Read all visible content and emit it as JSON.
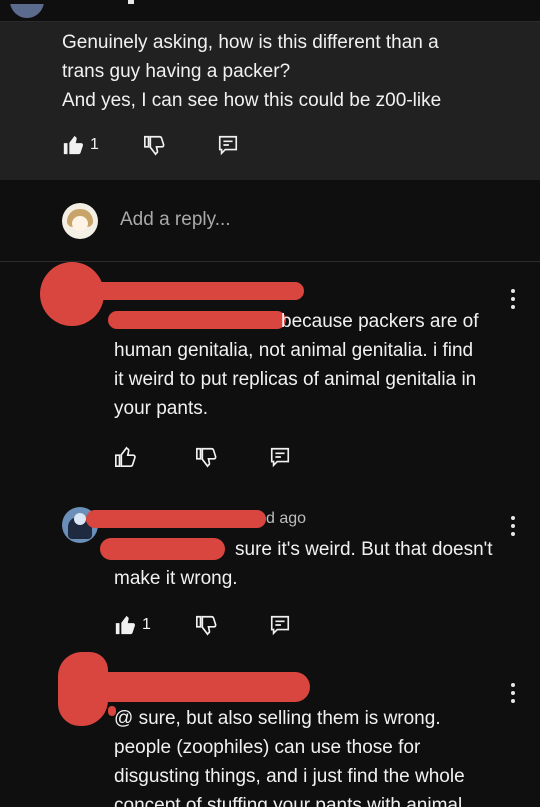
{
  "parent_comment": {
    "text_lines": [
      "Genuinely asking, how is this different than a",
      "trans guy having a packer?",
      "And yes, I can see how this could be z00-like"
    ],
    "like_count": "1"
  },
  "reply_box": {
    "placeholder": "Add a reply..."
  },
  "replies": [
    {
      "text_lines": [
        "because packers are of",
        "human genitalia, not animal genitalia. i find",
        "it weird to put replicas of animal genitalia in",
        "your pants."
      ],
      "like_count": ""
    },
    {
      "meta": "d ago",
      "text_lines": [
        "sure it's weird. But that doesn't",
        "make it wrong."
      ],
      "like_count": "1"
    },
    {
      "text_lines": [
        "@ sure, but also selling them is wrong.",
        "people (zoophiles) can use those for",
        "disgusting things, and i just find the whole",
        "concept of stuffing your pants with animal"
      ]
    }
  ],
  "colors": {
    "background": "#0f0f0f",
    "parent_background": "#212121",
    "redaction": "#d9453f"
  }
}
